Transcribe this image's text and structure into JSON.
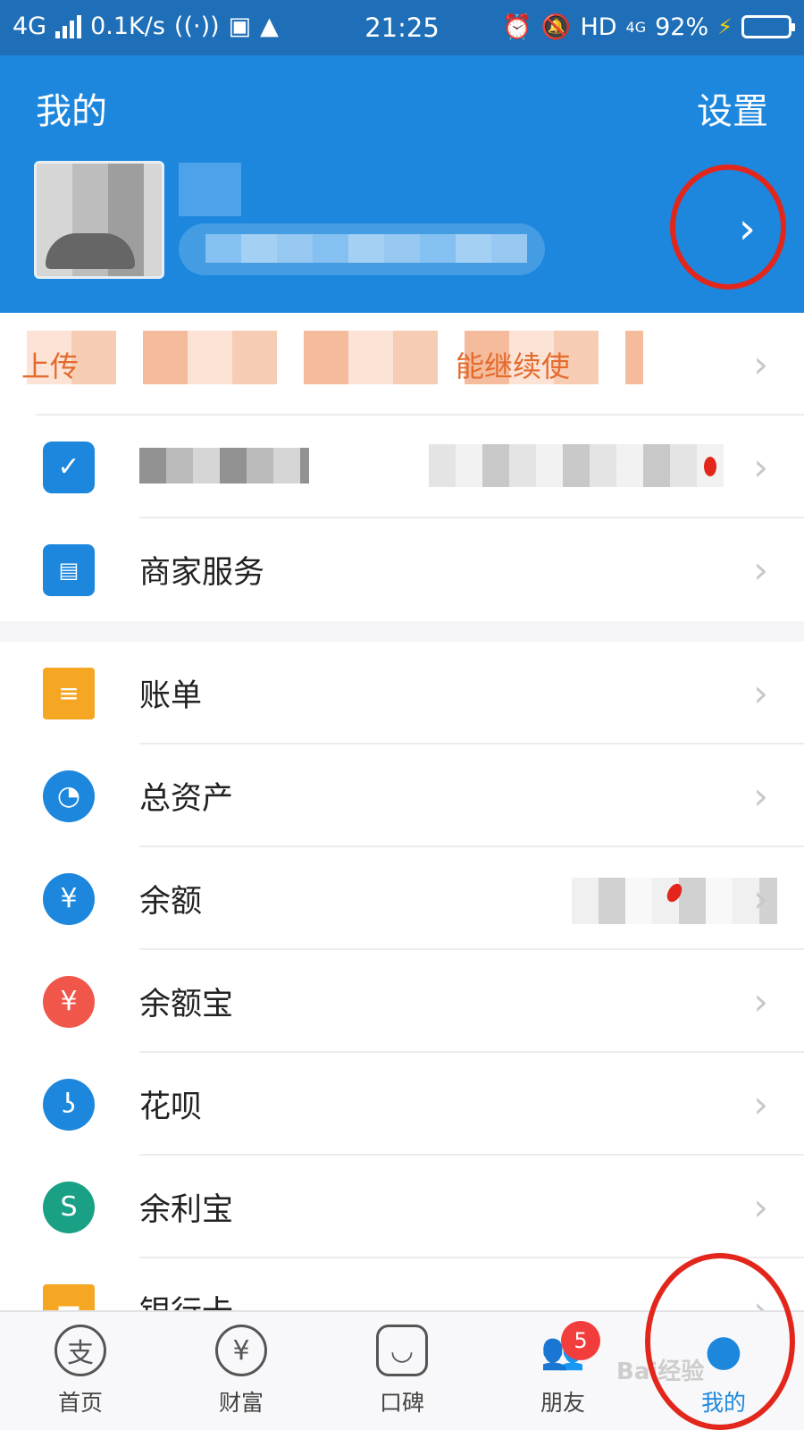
{
  "status": {
    "network": "4G",
    "speed": "0.1K/s",
    "time": "21:25",
    "hd": "HD",
    "hd_net": "4G",
    "battery": "92%",
    "battery_level": 0.92
  },
  "header": {
    "title": "我的",
    "settings_label": "设置"
  },
  "list_group1": [
    {
      "label": "上传",
      "type": "promo",
      "right": "能继续使"
    },
    {
      "label": "",
      "type": "member",
      "right": ""
    },
    {
      "label": "商家服务",
      "icon": "shop-icon"
    }
  ],
  "list_group2": [
    {
      "label": "账单",
      "icon": "bill-icon",
      "color": "#f5a623"
    },
    {
      "label": "总资产",
      "icon": "pie-chart-icon",
      "color": "#1c87dd"
    },
    {
      "label": "余额",
      "icon": "yuan-icon",
      "color": "#1c87dd"
    },
    {
      "label": "余额宝",
      "icon": "money-bag-icon",
      "color": "#f0564a"
    },
    {
      "label": "花呗",
      "icon": "huabei-icon",
      "color": "#1c87dd"
    },
    {
      "label": "余利宝",
      "icon": "yulibao-icon",
      "color": "#1aa085"
    },
    {
      "label": "银行卡",
      "icon": "bank-card-icon",
      "color": "#f5a623"
    }
  ],
  "tabs": [
    {
      "label": "首页",
      "glyph": "支",
      "icon": "home-icon"
    },
    {
      "label": "财富",
      "glyph": "¥",
      "icon": "wealth-icon"
    },
    {
      "label": "口碑",
      "glyph": "◡",
      "icon": "koubei-icon"
    },
    {
      "label": "朋友",
      "glyph": "👥",
      "icon": "friends-icon",
      "badge": "5"
    },
    {
      "label": "我的",
      "glyph": "●",
      "icon": "me-icon",
      "active": true
    }
  ],
  "watermark": "Bai经验"
}
